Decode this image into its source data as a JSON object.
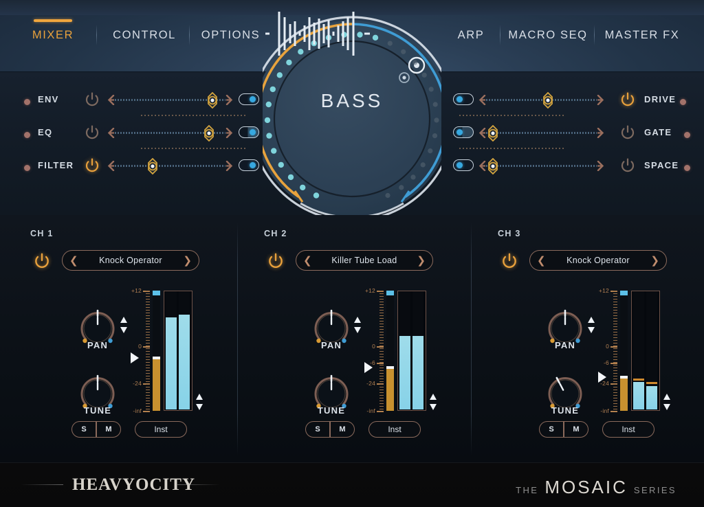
{
  "header": {
    "left_tabs": [
      {
        "label": "MIXER",
        "active": true
      },
      {
        "label": "CONTROL",
        "active": false
      },
      {
        "label": "OPTIONS",
        "active": false
      }
    ],
    "right_tabs": [
      {
        "label": "ARP",
        "active": false
      },
      {
        "label": "MACRO SEQ",
        "active": false
      },
      {
        "label": "MASTER FX",
        "active": false
      }
    ]
  },
  "main_knob": {
    "label": "BASS",
    "waveform_icon": "audio-waveform",
    "left_arc_color": "#e8a33d",
    "right_arc_color": "#3f9cd4",
    "dot_color": "#7fd4dc",
    "ring_color": "#d8e0e8",
    "left_arc_percent": 100,
    "right_arc_percent": 58
  },
  "fx_left": [
    {
      "name": "ENV",
      "power_on": false,
      "slider_value": 88,
      "toggle_on": true,
      "toggle_style": "full",
      "dot_color": "#a2726a"
    },
    {
      "name": "EQ",
      "power_on": false,
      "slider_value": 85,
      "toggle_on": true,
      "toggle_style": "half",
      "dot_color": "#a2726a"
    },
    {
      "name": "FILTER",
      "power_on": true,
      "slider_value": 34,
      "toggle_on": true,
      "toggle_style": "full",
      "dot_color": "#a2726a"
    }
  ],
  "fx_right": [
    {
      "name": "DRIVE",
      "power_on": true,
      "slider_value": 56,
      "toggle_on": true,
      "toggle_style": "full",
      "dot_color": "#a2726a"
    },
    {
      "name": "GATE",
      "power_on": false,
      "slider_value": 6,
      "toggle_on": true,
      "toggle_style": "half",
      "dot_color": "#a2726a"
    },
    {
      "name": "SPACE",
      "power_on": false,
      "slider_value": 6,
      "toggle_on": true,
      "toggle_style": "full",
      "dot_color": "#a2726a"
    }
  ],
  "channels": [
    {
      "title": "CH 1",
      "power_on": true,
      "preset": "Knock Operator",
      "prev_icon": "chevron-left-icon",
      "next_icon": "chevron-right-icon",
      "pan_label": "PAN",
      "pan_angle": 0,
      "tune_label": "TUNE",
      "tune_angle": 0,
      "scale_labels": [
        "+12",
        "0",
        "-24",
        "-inf"
      ],
      "fader_percent": 44,
      "meters": [
        78,
        80
      ],
      "meter_peaks": [],
      "solo_label": "S",
      "mute_label": "M",
      "inst_label": "Inst"
    },
    {
      "title": "CH 2",
      "power_on": true,
      "preset": "Killer Tube Load",
      "prev_icon": "chevron-left-icon",
      "next_icon": "chevron-right-icon",
      "pan_label": "PAN",
      "pan_angle": 0,
      "tune_label": "TUNE",
      "tune_angle": 0,
      "scale_labels": [
        "+12",
        "0",
        "-6",
        "-24",
        "-inf"
      ],
      "fader_percent": 36,
      "meters": [
        62,
        62
      ],
      "meter_peaks": [],
      "solo_label": "S",
      "mute_label": "M",
      "inst_label": "Inst"
    },
    {
      "title": "CH 3",
      "power_on": true,
      "preset": "Knock Operator",
      "prev_icon": "chevron-left-icon",
      "next_icon": "chevron-right-icon",
      "pan_label": "PAN",
      "pan_angle": 0,
      "tune_label": "TUNE",
      "tune_angle": -28,
      "scale_labels": [
        "+12",
        "0",
        "-6",
        "-24",
        "-inf"
      ],
      "fader_percent": 28,
      "meters": [
        23,
        20
      ],
      "meter_peaks": [
        25,
        22
      ],
      "solo_label": "S",
      "mute_label": "M",
      "inst_label": "Inst"
    }
  ],
  "footer": {
    "brand": "HEAVYOCITY",
    "series_the": "THE",
    "series_name": "MOSAIC",
    "series_suffix": "SERIES"
  }
}
